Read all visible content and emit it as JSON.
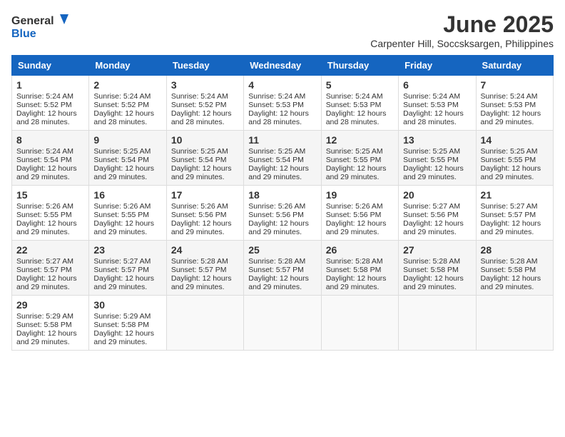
{
  "logo": {
    "general": "General",
    "blue": "Blue"
  },
  "header": {
    "title": "June 2025",
    "subtitle": "Carpenter Hill, Soccsksargen, Philippines"
  },
  "weekdays": [
    "Sunday",
    "Monday",
    "Tuesday",
    "Wednesday",
    "Thursday",
    "Friday",
    "Saturday"
  ],
  "weeks": [
    [
      {
        "day": "1",
        "rise": "Sunrise: 5:24 AM",
        "set": "Sunset: 5:52 PM",
        "daylight": "Daylight: 12 hours and 28 minutes."
      },
      {
        "day": "2",
        "rise": "Sunrise: 5:24 AM",
        "set": "Sunset: 5:52 PM",
        "daylight": "Daylight: 12 hours and 28 minutes."
      },
      {
        "day": "3",
        "rise": "Sunrise: 5:24 AM",
        "set": "Sunset: 5:52 PM",
        "daylight": "Daylight: 12 hours and 28 minutes."
      },
      {
        "day": "4",
        "rise": "Sunrise: 5:24 AM",
        "set": "Sunset: 5:53 PM",
        "daylight": "Daylight: 12 hours and 28 minutes."
      },
      {
        "day": "5",
        "rise": "Sunrise: 5:24 AM",
        "set": "Sunset: 5:53 PM",
        "daylight": "Daylight: 12 hours and 28 minutes."
      },
      {
        "day": "6",
        "rise": "Sunrise: 5:24 AM",
        "set": "Sunset: 5:53 PM",
        "daylight": "Daylight: 12 hours and 28 minutes."
      },
      {
        "day": "7",
        "rise": "Sunrise: 5:24 AM",
        "set": "Sunset: 5:53 PM",
        "daylight": "Daylight: 12 hours and 29 minutes."
      }
    ],
    [
      {
        "day": "8",
        "rise": "Sunrise: 5:24 AM",
        "set": "Sunset: 5:54 PM",
        "daylight": "Daylight: 12 hours and 29 minutes."
      },
      {
        "day": "9",
        "rise": "Sunrise: 5:25 AM",
        "set": "Sunset: 5:54 PM",
        "daylight": "Daylight: 12 hours and 29 minutes."
      },
      {
        "day": "10",
        "rise": "Sunrise: 5:25 AM",
        "set": "Sunset: 5:54 PM",
        "daylight": "Daylight: 12 hours and 29 minutes."
      },
      {
        "day": "11",
        "rise": "Sunrise: 5:25 AM",
        "set": "Sunset: 5:54 PM",
        "daylight": "Daylight: 12 hours and 29 minutes."
      },
      {
        "day": "12",
        "rise": "Sunrise: 5:25 AM",
        "set": "Sunset: 5:55 PM",
        "daylight": "Daylight: 12 hours and 29 minutes."
      },
      {
        "day": "13",
        "rise": "Sunrise: 5:25 AM",
        "set": "Sunset: 5:55 PM",
        "daylight": "Daylight: 12 hours and 29 minutes."
      },
      {
        "day": "14",
        "rise": "Sunrise: 5:25 AM",
        "set": "Sunset: 5:55 PM",
        "daylight": "Daylight: 12 hours and 29 minutes."
      }
    ],
    [
      {
        "day": "15",
        "rise": "Sunrise: 5:26 AM",
        "set": "Sunset: 5:55 PM",
        "daylight": "Daylight: 12 hours and 29 minutes."
      },
      {
        "day": "16",
        "rise": "Sunrise: 5:26 AM",
        "set": "Sunset: 5:55 PM",
        "daylight": "Daylight: 12 hours and 29 minutes."
      },
      {
        "day": "17",
        "rise": "Sunrise: 5:26 AM",
        "set": "Sunset: 5:56 PM",
        "daylight": "Daylight: 12 hours and 29 minutes."
      },
      {
        "day": "18",
        "rise": "Sunrise: 5:26 AM",
        "set": "Sunset: 5:56 PM",
        "daylight": "Daylight: 12 hours and 29 minutes."
      },
      {
        "day": "19",
        "rise": "Sunrise: 5:26 AM",
        "set": "Sunset: 5:56 PM",
        "daylight": "Daylight: 12 hours and 29 minutes."
      },
      {
        "day": "20",
        "rise": "Sunrise: 5:27 AM",
        "set": "Sunset: 5:56 PM",
        "daylight": "Daylight: 12 hours and 29 minutes."
      },
      {
        "day": "21",
        "rise": "Sunrise: 5:27 AM",
        "set": "Sunset: 5:57 PM",
        "daylight": "Daylight: 12 hours and 29 minutes."
      }
    ],
    [
      {
        "day": "22",
        "rise": "Sunrise: 5:27 AM",
        "set": "Sunset: 5:57 PM",
        "daylight": "Daylight: 12 hours and 29 minutes."
      },
      {
        "day": "23",
        "rise": "Sunrise: 5:27 AM",
        "set": "Sunset: 5:57 PM",
        "daylight": "Daylight: 12 hours and 29 minutes."
      },
      {
        "day": "24",
        "rise": "Sunrise: 5:28 AM",
        "set": "Sunset: 5:57 PM",
        "daylight": "Daylight: 12 hours and 29 minutes."
      },
      {
        "day": "25",
        "rise": "Sunrise: 5:28 AM",
        "set": "Sunset: 5:57 PM",
        "daylight": "Daylight: 12 hours and 29 minutes."
      },
      {
        "day": "26",
        "rise": "Sunrise: 5:28 AM",
        "set": "Sunset: 5:58 PM",
        "daylight": "Daylight: 12 hours and 29 minutes."
      },
      {
        "day": "27",
        "rise": "Sunrise: 5:28 AM",
        "set": "Sunset: 5:58 PM",
        "daylight": "Daylight: 12 hours and 29 minutes."
      },
      {
        "day": "28",
        "rise": "Sunrise: 5:28 AM",
        "set": "Sunset: 5:58 PM",
        "daylight": "Daylight: 12 hours and 29 minutes."
      }
    ],
    [
      {
        "day": "29",
        "rise": "Sunrise: 5:29 AM",
        "set": "Sunset: 5:58 PM",
        "daylight": "Daylight: 12 hours and 29 minutes."
      },
      {
        "day": "30",
        "rise": "Sunrise: 5:29 AM",
        "set": "Sunset: 5:58 PM",
        "daylight": "Daylight: 12 hours and 29 minutes."
      },
      {
        "day": "",
        "rise": "",
        "set": "",
        "daylight": ""
      },
      {
        "day": "",
        "rise": "",
        "set": "",
        "daylight": ""
      },
      {
        "day": "",
        "rise": "",
        "set": "",
        "daylight": ""
      },
      {
        "day": "",
        "rise": "",
        "set": "",
        "daylight": ""
      },
      {
        "day": "",
        "rise": "",
        "set": "",
        "daylight": ""
      }
    ]
  ]
}
